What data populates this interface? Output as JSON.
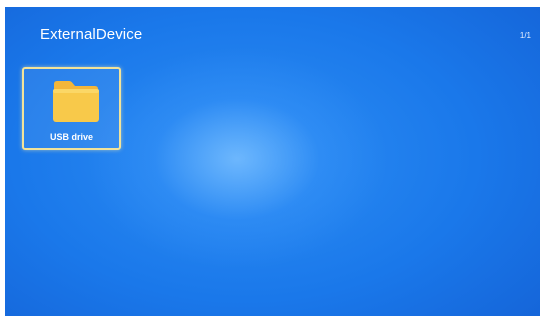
{
  "header": {
    "title": "ExternalDevice",
    "page_indicator": "1/1"
  },
  "devices": [
    {
      "label": "USB drive",
      "icon": "folder-icon",
      "selected": true
    }
  ],
  "colors": {
    "background_center": "#2d8ef4",
    "background_edge": "#1462d6",
    "focus_border": "#f1e39a",
    "folder": "#f8c94a"
  }
}
